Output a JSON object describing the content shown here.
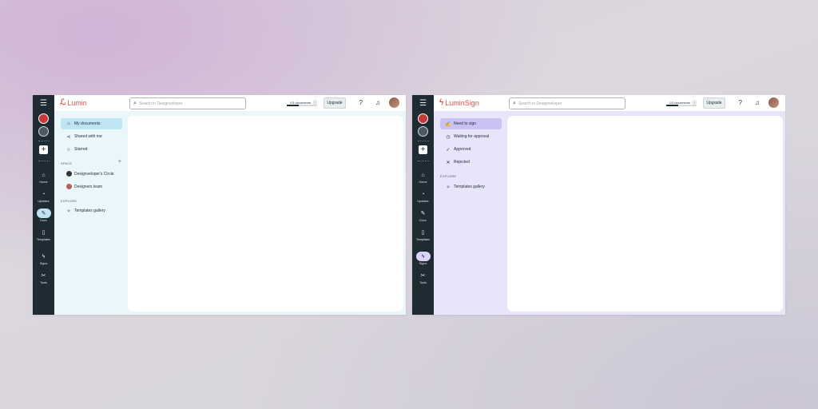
{
  "lumin": {
    "logo": "Lumin",
    "search_placeholder": "Search in Designveloper",
    "quota_text": "1/3 documents",
    "quota_fraction": 0.33,
    "upgrade": "Upgrade",
    "rail": {
      "home": "Home",
      "updates": "Updates",
      "docs": "Docs",
      "templates": "Templates",
      "signs": "Signs",
      "tools": "Tools"
    },
    "nav": {
      "my_documents": "My documents",
      "shared": "Shared with me",
      "starred": "Starred",
      "space_label": "SPACE",
      "space_add": "+",
      "circle": "Designveloper's Circle",
      "team": "Designers team",
      "explore_label": "EXPLORE",
      "gallery": "Templates gallery"
    }
  },
  "sign": {
    "logo": "LuminSign",
    "search_placeholder": "Search in Designveloper",
    "quota_text": "1/3 documents",
    "quota_fraction": 0.33,
    "upgrade": "Upgrade",
    "rail": {
      "home": "Home",
      "updates": "Updates",
      "docs": "Docs",
      "templates": "Templates",
      "signs": "Signs",
      "tools": "Tools"
    },
    "nav": {
      "need_to_sign": "Need to sign",
      "waiting": "Waiting for approval",
      "approved": "Approved",
      "rejected": "Rejected",
      "explore_label": "EXPLORE",
      "gallery": "Templates gallery"
    }
  },
  "colors": {
    "rail": "#1e2b33",
    "lumin_accent": "#e0504a",
    "lumin_panel": "#e9f7fb",
    "sign_panel": "#e8e5fa"
  }
}
